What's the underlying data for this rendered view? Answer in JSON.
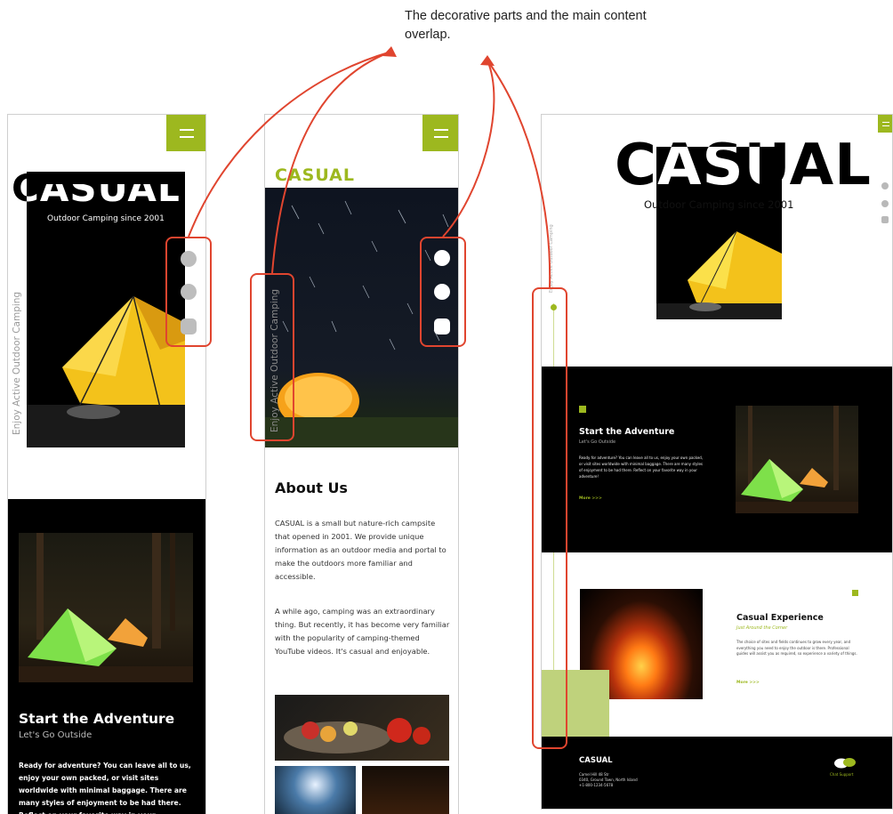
{
  "annotation": {
    "line1": "The decorative parts and the main content",
    "line2": "overlap."
  },
  "left_mobile": {
    "logo": "CASUAL",
    "tagline": "Outdoor Camping since 2001",
    "vertical_text": "Enjoy Active Outdoor Camping",
    "social_icons": [
      "twitter-icon",
      "facebook-icon",
      "instagram-icon"
    ],
    "section_title": "Start the Adventure",
    "section_subtitle": "Let's Go Outside",
    "section_body": "Ready for adventure? You can leave all to us, enjoy your own packed, or visit sites worldwide with minimal baggage. There are many styles of enjoyment to be had there. Reflect on your favorite way in your adventure!"
  },
  "middle_mobile": {
    "logo": "CASUAL",
    "vertical_text": "Enjoy Active Outdoor Camping",
    "social_icons": [
      "twitter-icon",
      "facebook-icon",
      "instagram-icon"
    ],
    "about_title": "About Us",
    "about_p1": "CASUAL is a small but nature-rich campsite that opened in 2001. We provide unique information as an outdoor media and portal to make the outdoors more familiar and accessible.",
    "about_p2": "A while ago, camping was an extraordinary thing. But recently, it has become very familiar with the popularity of camping-themed YouTube videos. It's casual and enjoyable."
  },
  "desktop": {
    "logo": "CASUAL",
    "tagline": "Outdoor Camping since 2001",
    "vertical_text": "Enjoy Active Outdoor Camping",
    "social_icons": [
      "twitter-icon",
      "facebook-icon",
      "instagram-icon"
    ],
    "adventure_title": "Start the Adventure",
    "adventure_subtitle": "Let's Go Outside",
    "adventure_body": "Ready for adventure? You can leave all to us, enjoy your own packed, or visit sites worldwide with minimal baggage. There are many styles of enjoyment to be had there. Reflect on your favorite way in your adventure!",
    "more_label": "More >>>",
    "experience_title": "Casual Experience",
    "experience_subtitle": "Just Around the Corner",
    "experience_body": "The choice of sites and fields continues to grow every year, and everything you need to enjoy the outdoor is there. Professional guides will assist you as required, so experience a variety of things.",
    "experience_more": "More >>>",
    "footer_logo": "CASUAL",
    "footer_address_1": "Camel Hill 48 Str",
    "footer_address_2": "0340, Ground Town, North Island",
    "footer_phone": "+1-800-1234-5678",
    "chat_label": "Chat Support"
  },
  "colors": {
    "accent": "#9db81f",
    "callout": "#e0452f",
    "tent_yellow": "#f3c21b",
    "tent_green": "#7ee04a"
  }
}
